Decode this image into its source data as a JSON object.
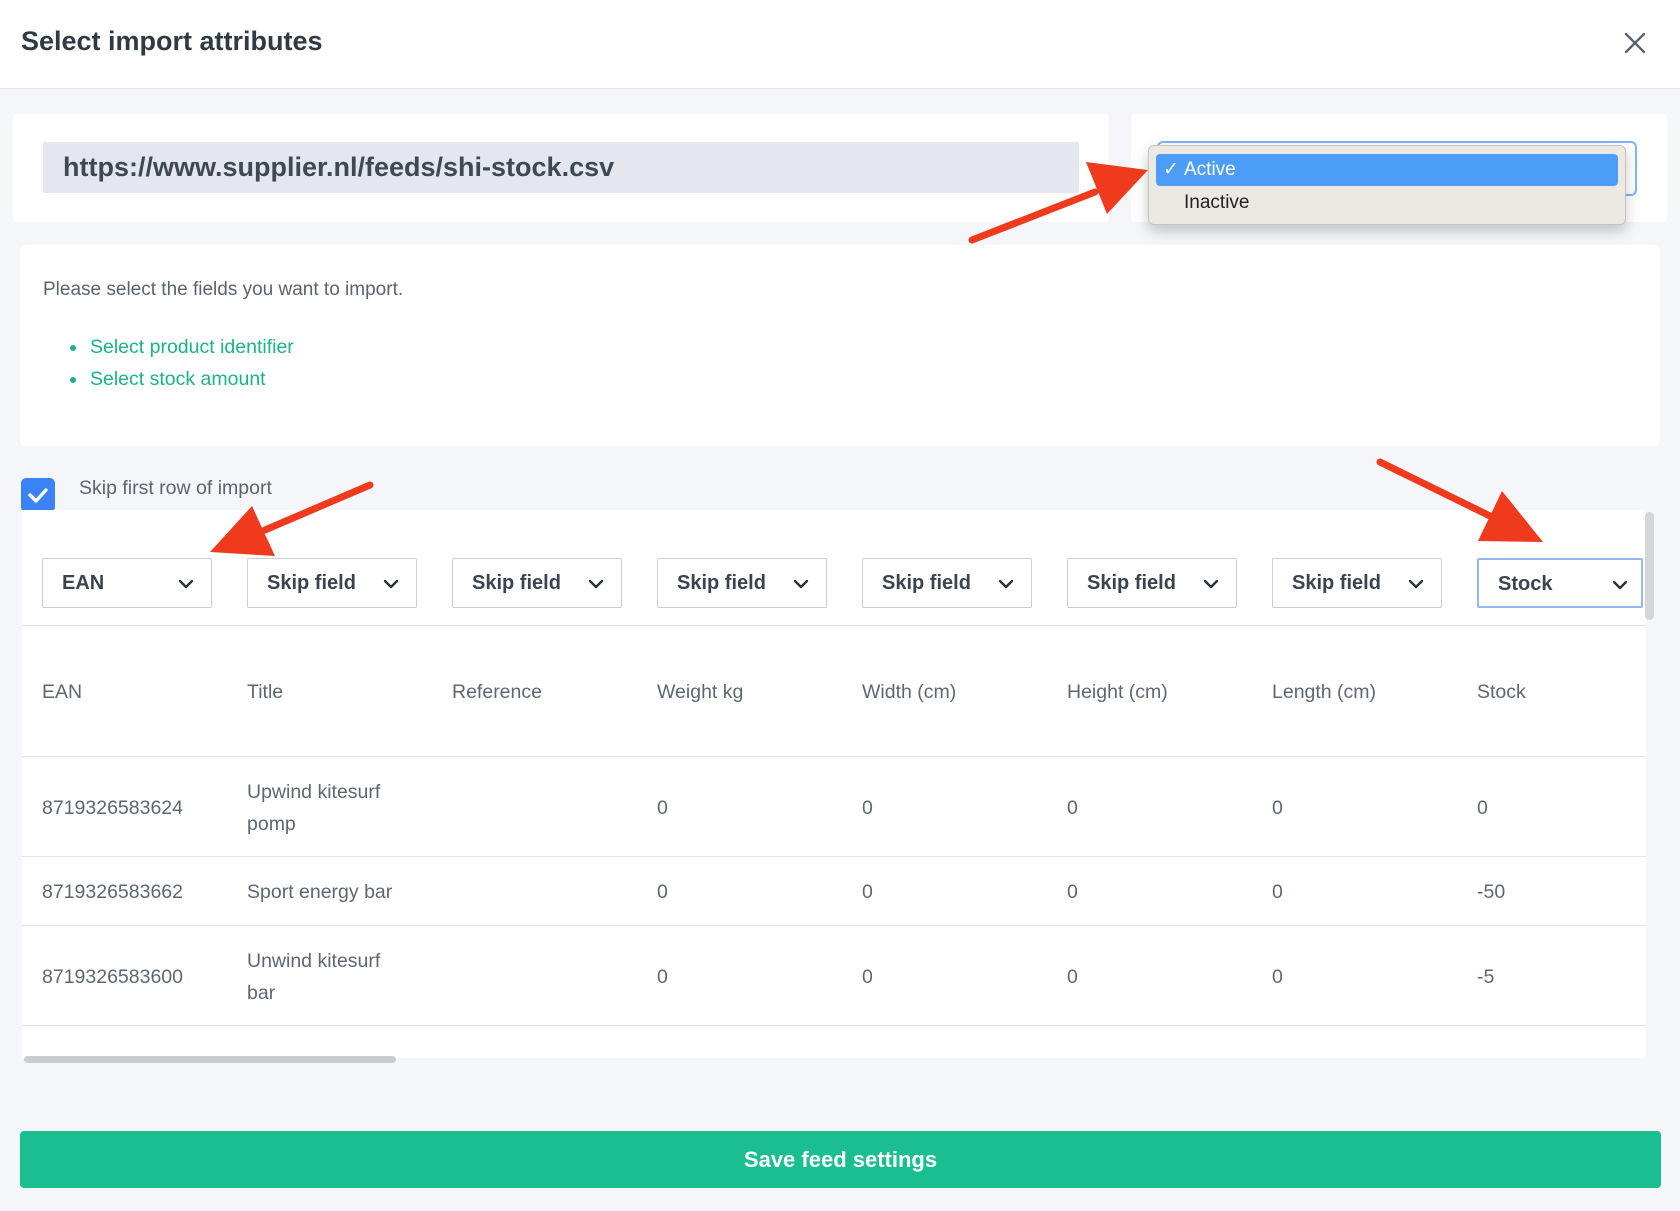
{
  "modal": {
    "title": "Select import attributes",
    "close_icon": "close-icon"
  },
  "feed": {
    "url": "https://www.supplier.nl/feeds/shi-stock.csv"
  },
  "status_dropdown": {
    "options": [
      {
        "label": "Active",
        "selected": true
      },
      {
        "label": "Inactive",
        "selected": false
      }
    ],
    "check_mark": "✓",
    "highlight_color": "#4b9df8"
  },
  "info": {
    "instruction": "Please select the fields you want to import.",
    "requirements": [
      "Select product identifier",
      "Select stock amount"
    ],
    "requirement_color": "#1bb389"
  },
  "options": {
    "skip_first_row_label": "Skip first row of import",
    "skip_first_row_checked": true
  },
  "table": {
    "field_mappings": [
      "EAN",
      "Skip field",
      "Skip field",
      "Skip field",
      "Skip field",
      "Skip field",
      "Skip field",
      "Stock"
    ],
    "headers": [
      "EAN",
      "Title",
      "Reference",
      "Weight kg",
      "Width (cm)",
      "Height (cm)",
      "Length (cm)",
      "Stock"
    ],
    "rows": [
      {
        "ean": "8719326583624",
        "title_line1": "Upwind kitesurf",
        "title_line2": "pomp",
        "reference": "",
        "weight": "0",
        "width": "0",
        "height": "0",
        "length": "0",
        "stock": "0"
      },
      {
        "ean": "8719326583662",
        "title_line1": "Sport energy bar",
        "title_line2": "",
        "reference": "",
        "weight": "0",
        "width": "0",
        "height": "0",
        "length": "0",
        "stock": "-50"
      },
      {
        "ean": "8719326583600",
        "title_line1": "Unwind kitesurf",
        "title_line2": "bar",
        "reference": "",
        "weight": "0",
        "width": "0",
        "height": "0",
        "length": "0",
        "stock": "-5"
      }
    ]
  },
  "footer": {
    "save_label": "Save feed settings",
    "save_color": "#1bbf8f"
  },
  "annotation_color": "#f03a1e"
}
